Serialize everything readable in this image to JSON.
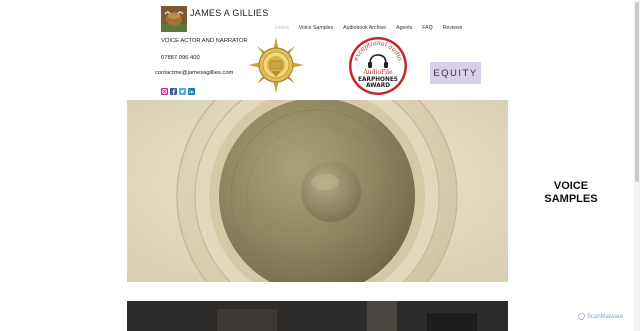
{
  "header": {
    "site_title": "JAMES A GILLIES",
    "subtitle": "VOICE ACTOR AND NARRATOR",
    "phone": "07887 996 400",
    "email": "contactme@jamesagillies.com"
  },
  "nav": {
    "items": [
      {
        "label": "Home",
        "active": true
      },
      {
        "label": "Voice Samples",
        "active": false
      },
      {
        "label": "Audiobook Archive",
        "active": false
      },
      {
        "label": "Agents",
        "active": false
      },
      {
        "label": "FAQ",
        "active": false
      },
      {
        "label": "Reviews",
        "active": false
      }
    ]
  },
  "social": [
    {
      "icon": "instagram-icon",
      "color": "#d6249f"
    },
    {
      "icon": "facebook-icon",
      "color": "#3b5998",
      "glyph": "f"
    },
    {
      "icon": "twitter-icon",
      "color": "#1da1f2",
      "glyph": "t"
    },
    {
      "icon": "linkedin-icon",
      "color": "#0e76a8",
      "glyph": "in"
    }
  ],
  "awards": {
    "earphones_top": "exceptional audio",
    "earphones_brand": "AudioFile",
    "earphones_line1": "EARPHONES",
    "earphones_line2": "AWARD"
  },
  "equity_label": "EQUITY",
  "voice_samples": {
    "line1": "VOICE",
    "line2": "SAMPLES"
  },
  "badge": "ScanMalware",
  "colors": {
    "equity_bg": "#d9cfe8",
    "hero_bg": "#e7dfc8",
    "award_red": "#c4262e",
    "gold": "#c9a441"
  }
}
